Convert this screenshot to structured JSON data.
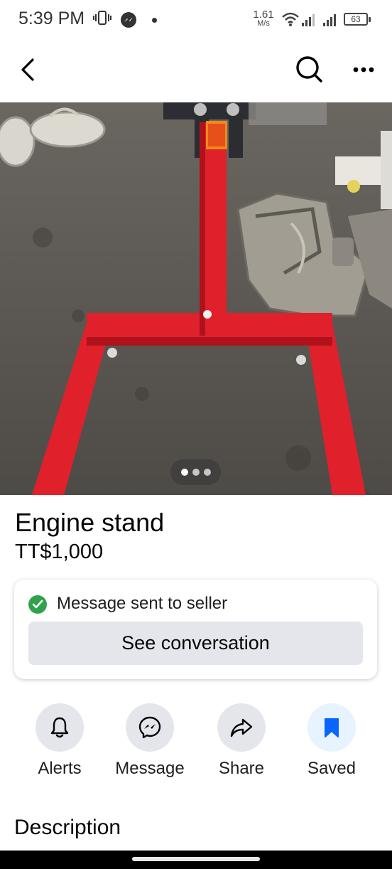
{
  "status_bar": {
    "time": "5:39 PM",
    "net_speed": "1.61",
    "net_speed_unit": "M/s",
    "battery": "63"
  },
  "header": {
    "back_icon": "back-icon",
    "search_icon": "search-icon",
    "more_icon": "more-icon"
  },
  "photo": {
    "subject": "red-engine-stand-photo",
    "page_count": 3,
    "active_page": 1
  },
  "listing": {
    "title": "Engine stand",
    "price": "TT$1,000"
  },
  "message_card": {
    "status_text": "Message sent to seller",
    "button_label": "See conversation",
    "status_color": "#31a24c"
  },
  "actions": [
    {
      "label": "Alerts",
      "icon": "bell-icon"
    },
    {
      "label": "Message",
      "icon": "messenger-icon"
    },
    {
      "label": "Share",
      "icon": "share-icon"
    },
    {
      "label": "Saved",
      "icon": "bookmark-icon"
    }
  ],
  "colors": {
    "accent": "#0866ff",
    "button_bg": "#e4e6eb"
  },
  "description_heading": "Description"
}
